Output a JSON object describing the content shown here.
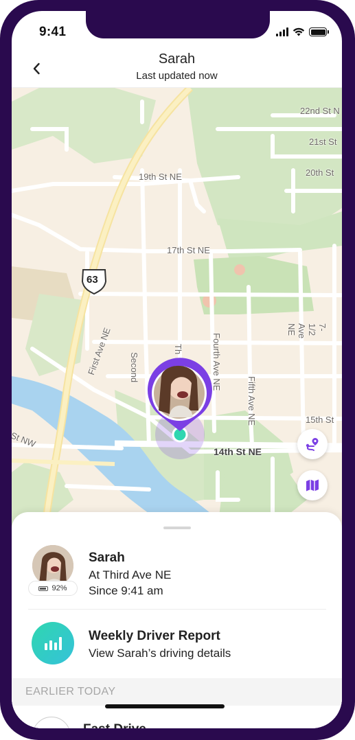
{
  "status": {
    "time": "9:41"
  },
  "header": {
    "title": "Sarah",
    "subtitle": "Last updated now",
    "back_icon": "chevron-left-icon"
  },
  "map": {
    "streets": {
      "s22": "22nd St N",
      "s21": "21st St",
      "s20": "20th St",
      "s19": "19th St NE",
      "s17": "17th St NE",
      "s15": "15th St",
      "s14": "14th St NE",
      "stnw": "St NW",
      "first_ave": "First Ave NE",
      "second_ave": "Second",
      "third_ave": "Th",
      "fourth_ave": "Fourth Ave NE",
      "fifth_ave": "Fifth Ave NE",
      "seventh_ave": "7-1/2 Ave NE",
      "route": "63"
    },
    "colors": {
      "land": "#f7efe3",
      "park": "#cfe5c0",
      "water": "#a9d3ef",
      "highway": "#f7e7a6",
      "marker": "#7b3fe4"
    },
    "buttons": {
      "route_icon": "route-pin-icon",
      "map_icon": "map-icon"
    }
  },
  "sheet": {
    "person": {
      "name": "Sarah",
      "location": "At Third Ave NE",
      "since": "Since 9:41 am",
      "battery": "92%"
    },
    "report": {
      "title": "Weekly Driver Report",
      "subtitle": "View Sarah’s driving details",
      "icon": "bar-chart-icon"
    },
    "section_header": "EARLIER TODAY",
    "partial_item": "Fast Drive"
  },
  "accent": "#7b3fe4"
}
